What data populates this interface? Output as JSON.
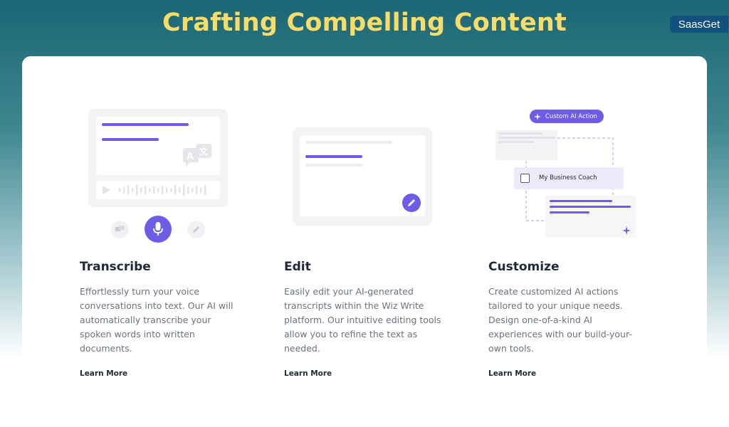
{
  "header": {
    "title": "Crafting Compelling Content",
    "brand": "SaasGet"
  },
  "columns": [
    {
      "title": "Transcribe",
      "description": "Effortlessly turn your voice conversations into text. Our AI will automatically transcribe your spoken words into written documents.",
      "link": "Learn More"
    },
    {
      "title": "Edit",
      "description": "Easily edit your AI-generated transcripts within the Wiz Write platform. Our intuitive editing tools allow you to refine the text as needed.",
      "link": "Learn More"
    },
    {
      "title": "Customize",
      "description": "Create customized AI actions tailored to your unique needs. Design one-of-a-kind AI experiences with our build-your-own tools.",
      "link": "Learn More"
    }
  ],
  "illustration": {
    "custom_action_label": "Custom AI Action",
    "business_coach_label": "My Business Coach"
  },
  "colors": {
    "accent": "#6e5be6",
    "title": "#f6dc6a",
    "brand_bg": "#12507d"
  },
  "icons": {
    "translate": "translate-icon",
    "play": "play-icon",
    "mic": "microphone-icon",
    "pencil": "pencil-icon",
    "sparkle": "sparkle-icon",
    "chat": "chat-icon"
  }
}
